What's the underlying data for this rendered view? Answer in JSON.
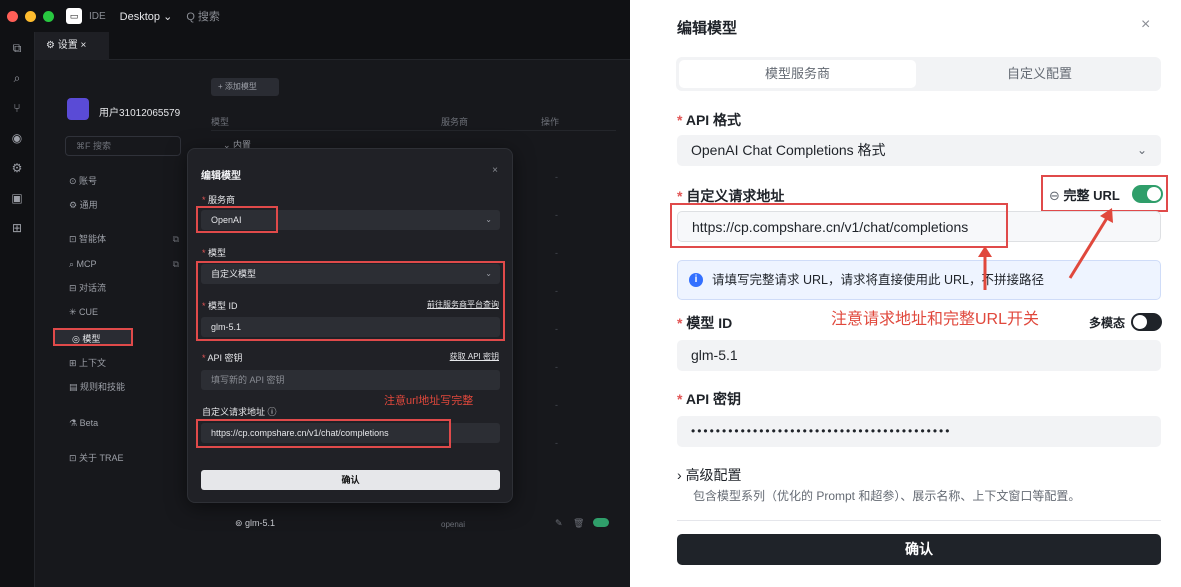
{
  "ide": {
    "topbar": {
      "app_label": "IDE",
      "workspace": "Desktop ⌄",
      "search": "Q 搜索"
    },
    "tab": {
      "label": "⚙ 设置 ×"
    },
    "sidebar": {
      "user": "用户31012065579",
      "search": "⌘F 搜索",
      "items": [
        {
          "label": "⊙  账号"
        },
        {
          "label": "⚙  通用"
        },
        {
          "label": "⊡  智能体"
        },
        {
          "label": "⌕  MCP"
        },
        {
          "label": "⊟  对话流"
        },
        {
          "label": "✳  CUE"
        },
        {
          "label": "◎  模型"
        },
        {
          "label": "⊞  上下文"
        },
        {
          "label": "▤  规则和技能"
        },
        {
          "label": "⚗  Beta"
        },
        {
          "label": "⊡  关于 TRAE"
        }
      ]
    },
    "main": {
      "add_model": "+ 添加模型",
      "headers": {
        "model": "模型",
        "provider": "服务商",
        "action": "操作"
      },
      "group": "⌄ 内置",
      "row": {
        "name": "⊚  glm-5.1",
        "provider": "openai"
      }
    },
    "dialog": {
      "title": "编辑模型",
      "close": "×",
      "provider_label": "服务商",
      "provider_value": "OpenAI",
      "model_label": "模型",
      "model_value": "自定义模型",
      "model_id_label": "模型 ID",
      "model_id_link": "前往服务商平台查询",
      "model_id_value": "glm-5.1",
      "api_key_label": "API 密钥",
      "api_key_link": "获取 API 密钥",
      "api_key_placeholder": "填写新的 API 密钥",
      "url_label": "自定义请求地址 ⓘ",
      "url_value": "https://cp.compshare.cn/v1/chat/completions",
      "annotation": "注意url地址写完整",
      "confirm": "确认"
    }
  },
  "panel": {
    "title": "编辑模型",
    "close": "×",
    "tabs": [
      "模型服务商",
      "自定义配置"
    ],
    "api_format_label": "API 格式",
    "api_format_value": "OpenAI Chat Completions 格式",
    "url_label": "自定义请求地址",
    "full_url_label": "完整 URL",
    "url_value": "https://cp.compshare.cn/v1/chat/completions",
    "info": "请填写完整请求 URL，请求将直接使用此 URL，不拼接路径",
    "annotation": "注意请求地址和完整URL开关",
    "model_id_label": "模型 ID",
    "multimodal_label": "多模态",
    "model_id_value": "glm-5.1",
    "api_key_label": "API 密钥",
    "api_key_value": "••••••••••••••••••••••••••••••••••••••••••",
    "advanced_label": "高级配置",
    "advanced_desc": "包含模型系列（优化的 Prompt 和超参）、展示名称、上下文窗口等配置。",
    "confirm": "确认",
    "full_url_toggle_on": true,
    "multimodal_toggle_on": false
  },
  "colors": {
    "accent_green": "#2f9e6a",
    "annotation_red": "#e0483c",
    "info_blue": "#3370ff"
  }
}
